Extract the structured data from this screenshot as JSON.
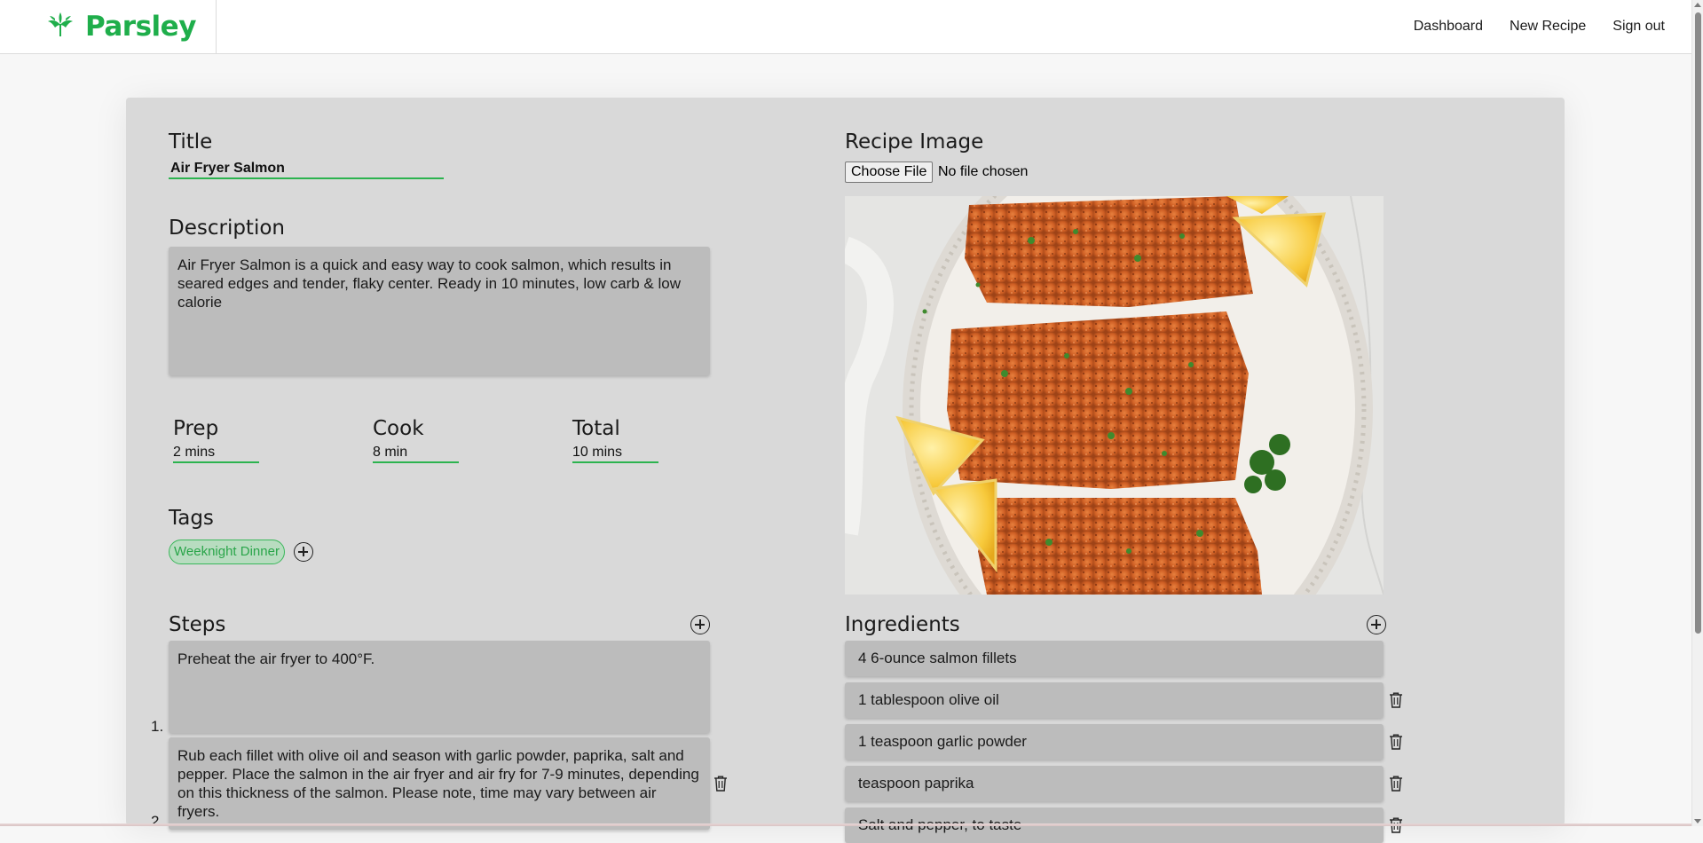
{
  "brand": {
    "name": "Parsley",
    "accent": "#1fae4b"
  },
  "nav": {
    "items": [
      "Dashboard",
      "New Recipe",
      "Sign out"
    ]
  },
  "form": {
    "title_label": "Title",
    "title_value": "Air Fryer Salmon",
    "description_label": "Description",
    "description_value": "Air Fryer Salmon is a quick and easy way to cook salmon, which results in seared edges and tender, flaky center. Ready in 10 minutes, low carb & low calorie",
    "prep_label": "Prep",
    "prep_value": "2 mins",
    "cook_label": "Cook",
    "cook_value": "8 min",
    "total_label": "Total",
    "total_value": "10 mins",
    "tags_label": "Tags",
    "tags": [
      "Weeknight Dinner"
    ],
    "steps_label": "Steps",
    "steps": [
      "Preheat the air fryer to 400°F.",
      "Rub each fillet with olive oil and season with garlic powder, paprika, salt and pepper. Place the salmon in the air fryer and air fry for 7-9 minutes, depending on this thickness of the salmon. Please note, time may vary between air fryers."
    ],
    "step_numbers": [
      "1.",
      "2."
    ],
    "image_label": "Recipe Image",
    "file_button": "Choose File",
    "file_status": "No file chosen",
    "ingredients_label": "Ingredients",
    "ingredients": [
      "4 6-ounce salmon fillets",
      "1 tablespoon olive oil",
      "1 teaspoon garlic powder",
      " teaspoon paprika",
      "Salt and pepper, to taste"
    ]
  },
  "icons": {
    "logo": "parsley-leaf-icon",
    "add": "circle-plus-icon",
    "delete": "trash-icon"
  },
  "colors": {
    "accent_green": "#2cb34f",
    "card_bg": "#d9d9d9",
    "field_bg": "#bcbcbc",
    "tag_bg": "#b8dcc0"
  }
}
